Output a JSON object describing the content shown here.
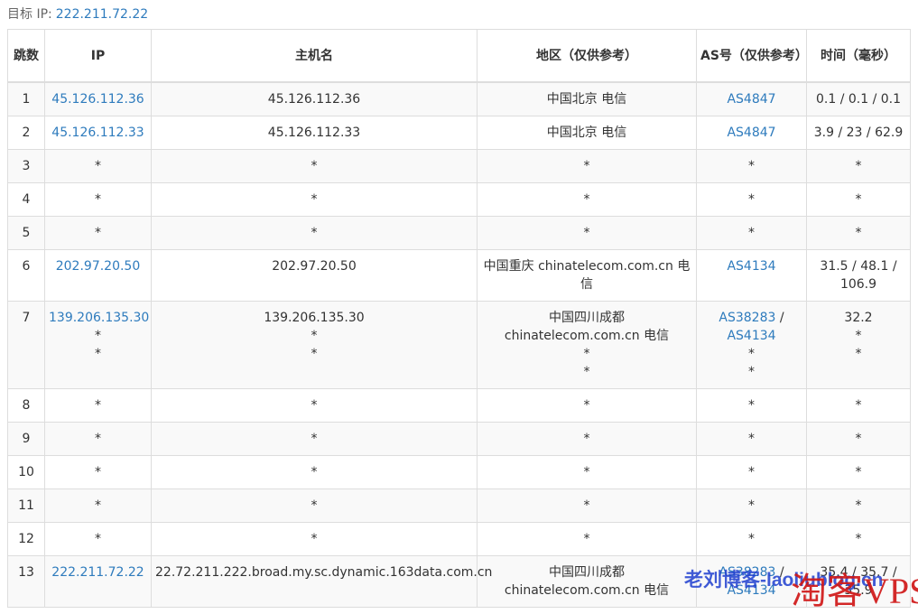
{
  "target": {
    "label": "目标 IP:",
    "ip": "222.211.72.22"
  },
  "columns": [
    "跳数",
    "IP",
    "主机名",
    "地区（仅供参考）",
    "AS号（仅供参考）",
    "时间（毫秒）"
  ],
  "rows": [
    {
      "hop": "1",
      "ip": [
        "45.126.112.36"
      ],
      "host": [
        "45.126.112.36"
      ],
      "region": [
        "中国北京 电信"
      ],
      "as": [
        [
          "AS4847"
        ]
      ],
      "time": [
        "0.1 / 0.1 / 0.1"
      ]
    },
    {
      "hop": "2",
      "ip": [
        "45.126.112.33"
      ],
      "host": [
        "45.126.112.33"
      ],
      "region": [
        "中国北京 电信"
      ],
      "as": [
        [
          "AS4847"
        ]
      ],
      "time": [
        "3.9 / 23 / 62.9"
      ]
    },
    {
      "hop": "3",
      "ip": [
        "*"
      ],
      "host": [
        "*"
      ],
      "region": [
        "*"
      ],
      "as": [
        [
          "*"
        ]
      ],
      "time": [
        "*"
      ]
    },
    {
      "hop": "4",
      "ip": [
        "*"
      ],
      "host": [
        "*"
      ],
      "region": [
        "*"
      ],
      "as": [
        [
          "*"
        ]
      ],
      "time": [
        "*"
      ]
    },
    {
      "hop": "5",
      "ip": [
        "*"
      ],
      "host": [
        "*"
      ],
      "region": [
        "*"
      ],
      "as": [
        [
          "*"
        ]
      ],
      "time": [
        "*"
      ]
    },
    {
      "hop": "6",
      "ip": [
        "202.97.20.50"
      ],
      "host": [
        "202.97.20.50"
      ],
      "region": [
        "中国重庆 chinatelecom.com.cn 电",
        "信"
      ],
      "as": [
        [
          "AS4134"
        ]
      ],
      "time": [
        "31.5 / 48.1 /",
        "106.9"
      ]
    },
    {
      "hop": "7",
      "ip": [
        "139.206.135.30",
        "*",
        "*"
      ],
      "host": [
        "139.206.135.30",
        "*",
        "*"
      ],
      "region": [
        "中国四川成都",
        "chinatelecom.com.cn 电信",
        "*",
        "*"
      ],
      "as": [
        [
          "AS38283",
          " /"
        ],
        [
          "AS4134"
        ],
        [
          "*"
        ],
        [
          "*"
        ]
      ],
      "time": [
        "32.2",
        "*",
        "*"
      ]
    },
    {
      "hop": "8",
      "ip": [
        "*"
      ],
      "host": [
        "*"
      ],
      "region": [
        "*"
      ],
      "as": [
        [
          "*"
        ]
      ],
      "time": [
        "*"
      ]
    },
    {
      "hop": "9",
      "ip": [
        "*"
      ],
      "host": [
        "*"
      ],
      "region": [
        "*"
      ],
      "as": [
        [
          "*"
        ]
      ],
      "time": [
        "*"
      ]
    },
    {
      "hop": "10",
      "ip": [
        "*"
      ],
      "host": [
        "*"
      ],
      "region": [
        "*"
      ],
      "as": [
        [
          "*"
        ]
      ],
      "time": [
        "*"
      ]
    },
    {
      "hop": "11",
      "ip": [
        "*"
      ],
      "host": [
        "*"
      ],
      "region": [
        "*"
      ],
      "as": [
        [
          "*"
        ]
      ],
      "time": [
        "*"
      ]
    },
    {
      "hop": "12",
      "ip": [
        "*"
      ],
      "host": [
        "*"
      ],
      "region": [
        "*"
      ],
      "as": [
        [
          "*"
        ]
      ],
      "time": [
        "*"
      ]
    },
    {
      "hop": "13",
      "ip": [
        "222.211.72.22"
      ],
      "host": [
        "22.72.211.222.broad.my.sc.dynamic.163data.com.cn"
      ],
      "region": [
        "中国四川成都",
        "chinatelecom.com.cn 电信"
      ],
      "as": [
        [
          "AS38283",
          " /"
        ],
        [
          "AS4134"
        ]
      ],
      "time": [
        "35.4 / 35.7 /",
        "35.9"
      ]
    }
  ],
  "watermark": {
    "text": "老刘博客-laoliublog.cn",
    "brand": "淘客VPS"
  }
}
